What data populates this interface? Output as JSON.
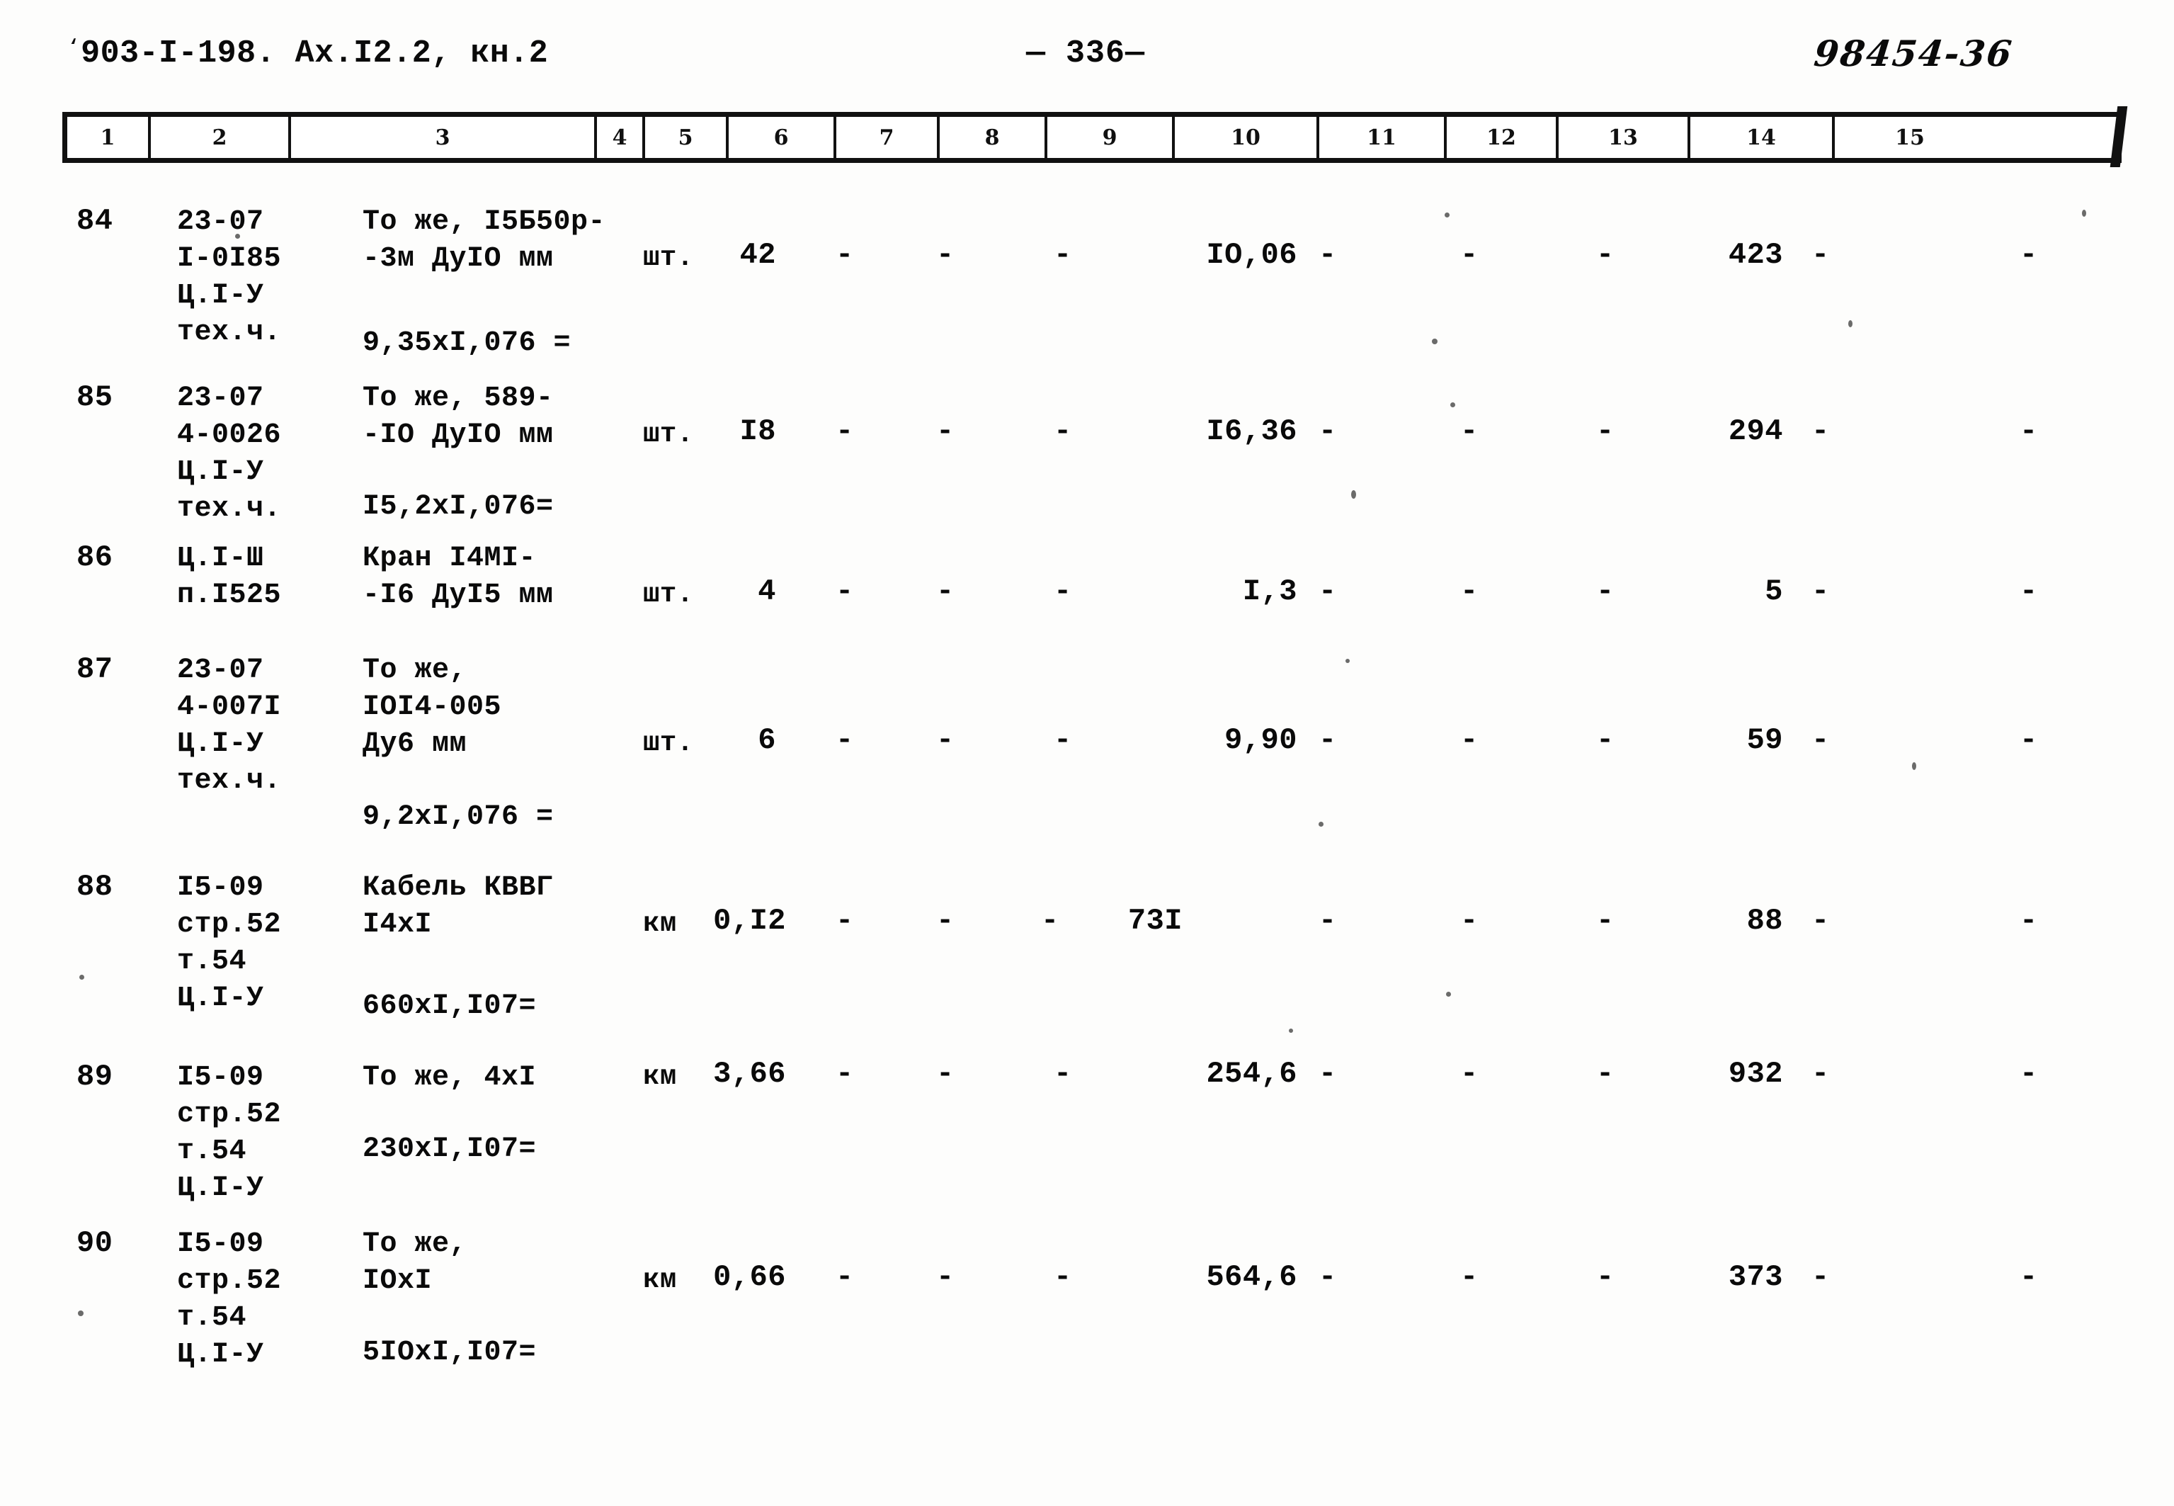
{
  "header": {
    "doc_code": "903-I-198",
    "doc_suffix": ". Ах.I2.2, кн.2",
    "leading_tick": "⸺",
    "page_number": "— 336—",
    "archive_number": "98454-36"
  },
  "table": {
    "column_numbers": [
      "1",
      "2",
      "3",
      "4",
      "5",
      "6",
      "7",
      "8",
      "9",
      "10",
      "11",
      "12",
      "13",
      "14",
      "15"
    ],
    "rows": [
      {
        "num": "84",
        "code_lines": [
          "23-07",
          "I-0I85",
          "Ц.I-У",
          "тех.ч."
        ],
        "name_lines": [
          "То же, I5Б50р-",
          "-3м ДуIO мм"
        ],
        "calc": "9,35xI,076 =",
        "unit": "шт.",
        "qty": "42",
        "c6": "-",
        "c7": "-",
        "c8": "-",
        "c9": "IO,06",
        "c10": "-",
        "c11": "-",
        "c12": "-",
        "c13": "423",
        "c14": "-",
        "c15": "-"
      },
      {
        "num": "85",
        "code_lines": [
          "23-07",
          "4-0026",
          "Ц.I-У",
          "тех.ч."
        ],
        "name_lines": [
          "То же, 589-",
          "-IO ДуIO мм"
        ],
        "calc": "I5,2xI,076=",
        "unit": "шт.",
        "qty": "I8",
        "c6": "-",
        "c7": "-",
        "c8": "-",
        "c9": "I6,36",
        "c10": "-",
        "c11": "-",
        "c12": "-",
        "c13": "294",
        "c14": "-",
        "c15": "-"
      },
      {
        "num": "86",
        "code_lines": [
          "Ц.I-Ш",
          "п.I525"
        ],
        "name_lines": [
          "Кран I4MI-",
          "-I6 ДуI5 мм"
        ],
        "calc": "",
        "unit": "шт.",
        "qty": "4",
        "c6": "-",
        "c7": "-",
        "c8": "-",
        "c9": "I,3",
        "c10": "-",
        "c11": "-",
        "c12": "-",
        "c13": "5",
        "c14": "-",
        "c15": "-"
      },
      {
        "num": "87",
        "code_lines": [
          "23-07",
          "4-007I",
          "Ц.I-У",
          "тех.ч."
        ],
        "name_lines": [
          "То же,",
          "IOI4-005",
          "Ду6 мм"
        ],
        "calc": "9,2xI,076 =",
        "unit": "шт.",
        "qty": "6",
        "c6": "-",
        "c7": "-",
        "c8": "-",
        "c9": "9,90",
        "c10": "-",
        "c11": "-",
        "c12": "-",
        "c13": "59",
        "c14": "-",
        "c15": "-"
      },
      {
        "num": "88",
        "code_lines": [
          "I5-09",
          "стр.52",
          "т.54",
          "Ц.I-У"
        ],
        "name_lines": [
          "Кабель КВВГ",
          "I4xI"
        ],
        "calc": "660xI,I07=",
        "unit": "км",
        "qty": "0,I2",
        "c6": "-",
        "c7": "-",
        "c8": "-",
        "c9": "73I",
        "c10": "-",
        "c11": "-",
        "c12": "-",
        "c13": "88",
        "c14": "-",
        "c15": "-"
      },
      {
        "num": "89",
        "code_lines": [
          "I5-09",
          "стр.52",
          "т.54",
          "Ц.I-У"
        ],
        "name_lines": [
          "То же, 4xI"
        ],
        "calc": "230xI,I07=",
        "unit": "км",
        "qty": "3,66",
        "c6": "-",
        "c7": "-",
        "c8": "-",
        "c9": "254,6",
        "c10": "-",
        "c11": "-",
        "c12": "-",
        "c13": "932",
        "c14": "-",
        "c15": "-"
      },
      {
        "num": "90",
        "code_lines": [
          "I5-09",
          "стр.52",
          "т.54",
          "Ц.I-У"
        ],
        "name_lines": [
          "То же,",
          "IOxI"
        ],
        "calc": "5IOxI,I07=",
        "unit": "км",
        "qty": "0,66",
        "c6": "-",
        "c7": "-",
        "c8": "-",
        "c9": "564,6",
        "c10": "-",
        "c11": "-",
        "c12": "-",
        "c13": "373",
        "c14": "-",
        "c15": "-"
      }
    ]
  }
}
